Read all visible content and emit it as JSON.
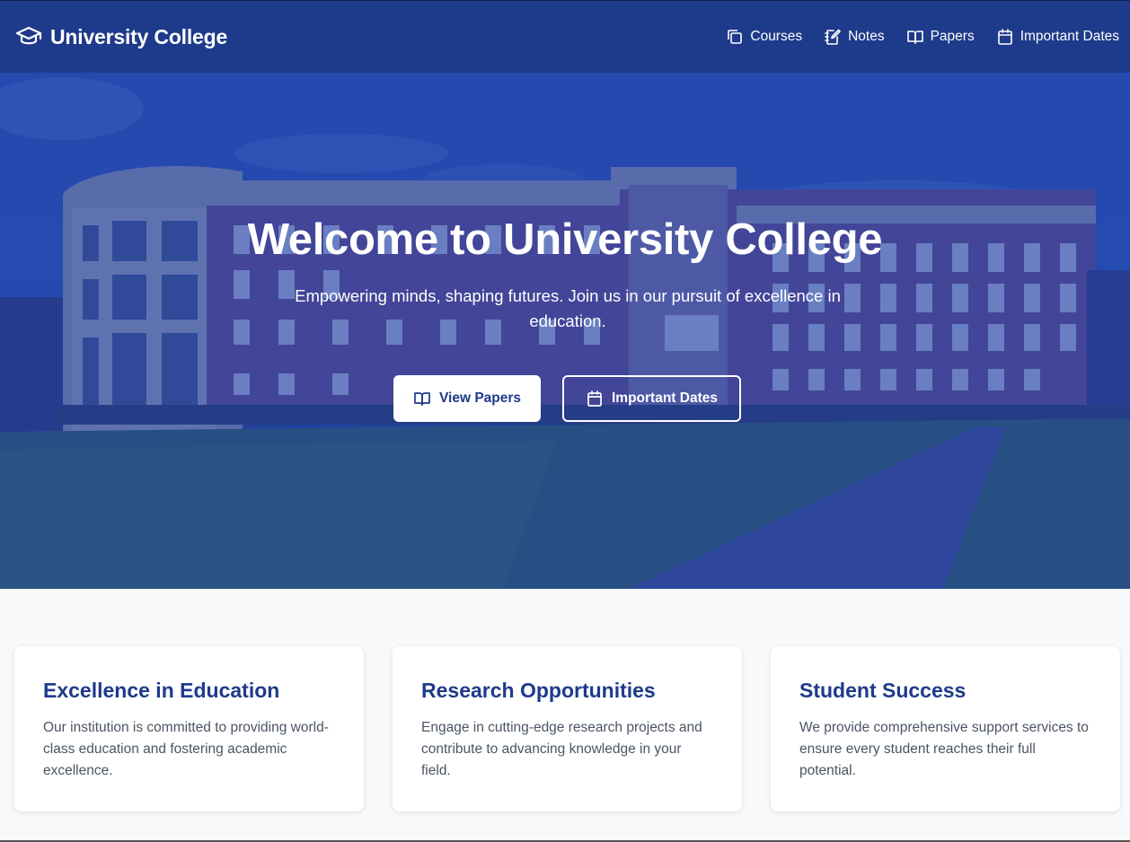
{
  "brand": {
    "title": "University College",
    "icon": "graduation-cap-icon"
  },
  "nav": [
    {
      "label": "Courses",
      "icon": "copy-icon"
    },
    {
      "label": "Notes",
      "icon": "notebook-pen-icon"
    },
    {
      "label": "Papers",
      "icon": "book-open-icon"
    },
    {
      "label": "Important Dates",
      "icon": "calendar-icon"
    }
  ],
  "hero": {
    "title": "Welcome to University College",
    "subtitle": "Empowering minds, shaping futures. Join us in our pursuit of excellence in education.",
    "primary_button": "View Papers",
    "secondary_button": "Important Dates"
  },
  "cards": [
    {
      "title": "Excellence in Education",
      "text": "Our institution is committed to providing world-class education and fostering academic excellence."
    },
    {
      "title": "Research Opportunities",
      "text": "Engage in cutting-edge research projects and contribute to advancing knowledge in your field."
    },
    {
      "title": "Student Success",
      "text": "We provide comprehensive support services to ensure every student reaches their full potential."
    }
  ],
  "colors": {
    "primary": "#1e3a8a",
    "overlay": "#2b51b0",
    "text_muted": "#4b5563",
    "background": "#f8f9fb"
  }
}
